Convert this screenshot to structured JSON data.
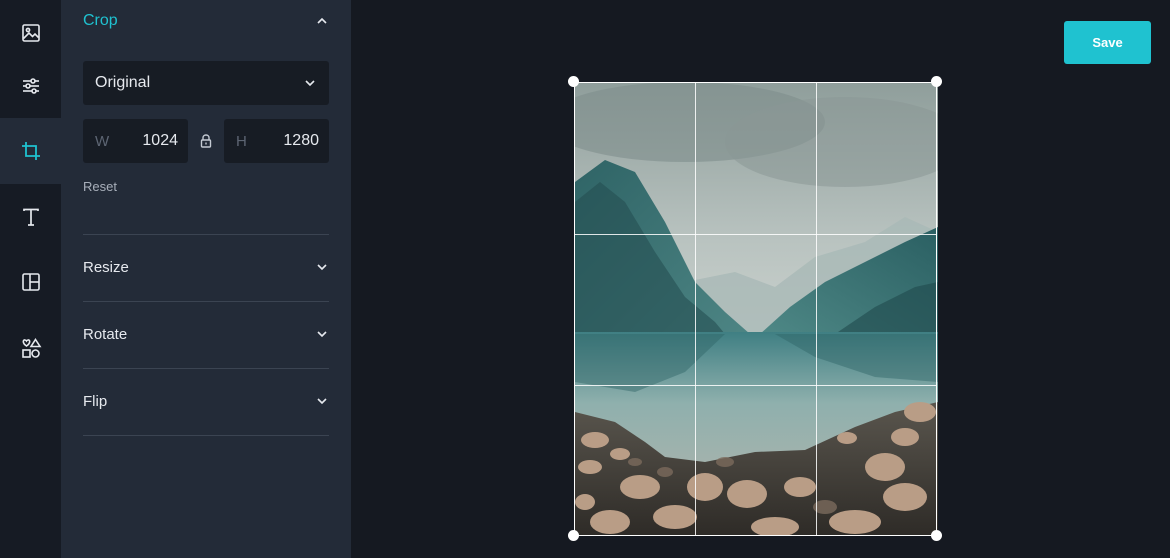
{
  "toolbar": {
    "tools": [
      {
        "id": "image",
        "icon": "image-icon"
      },
      {
        "id": "adjust",
        "icon": "sliders-icon"
      },
      {
        "id": "crop",
        "icon": "crop-icon",
        "active": true
      },
      {
        "id": "text",
        "icon": "text-icon"
      },
      {
        "id": "layout",
        "icon": "layout-icon"
      },
      {
        "id": "elements",
        "icon": "shapes-icon"
      }
    ]
  },
  "panel": {
    "crop": {
      "title": "Crop",
      "preset": "Original",
      "width_label": "W",
      "width_value": "1024",
      "height_label": "H",
      "height_value": "1280",
      "reset_label": "Reset"
    },
    "sections": [
      {
        "label": "Resize"
      },
      {
        "label": "Rotate"
      },
      {
        "label": "Flip"
      }
    ]
  },
  "header": {
    "save_label": "Save"
  },
  "colors": {
    "accent": "#1fc2d0",
    "panel_bg": "#232b38",
    "canvas_bg": "#151921",
    "input_bg": "#171c24"
  }
}
